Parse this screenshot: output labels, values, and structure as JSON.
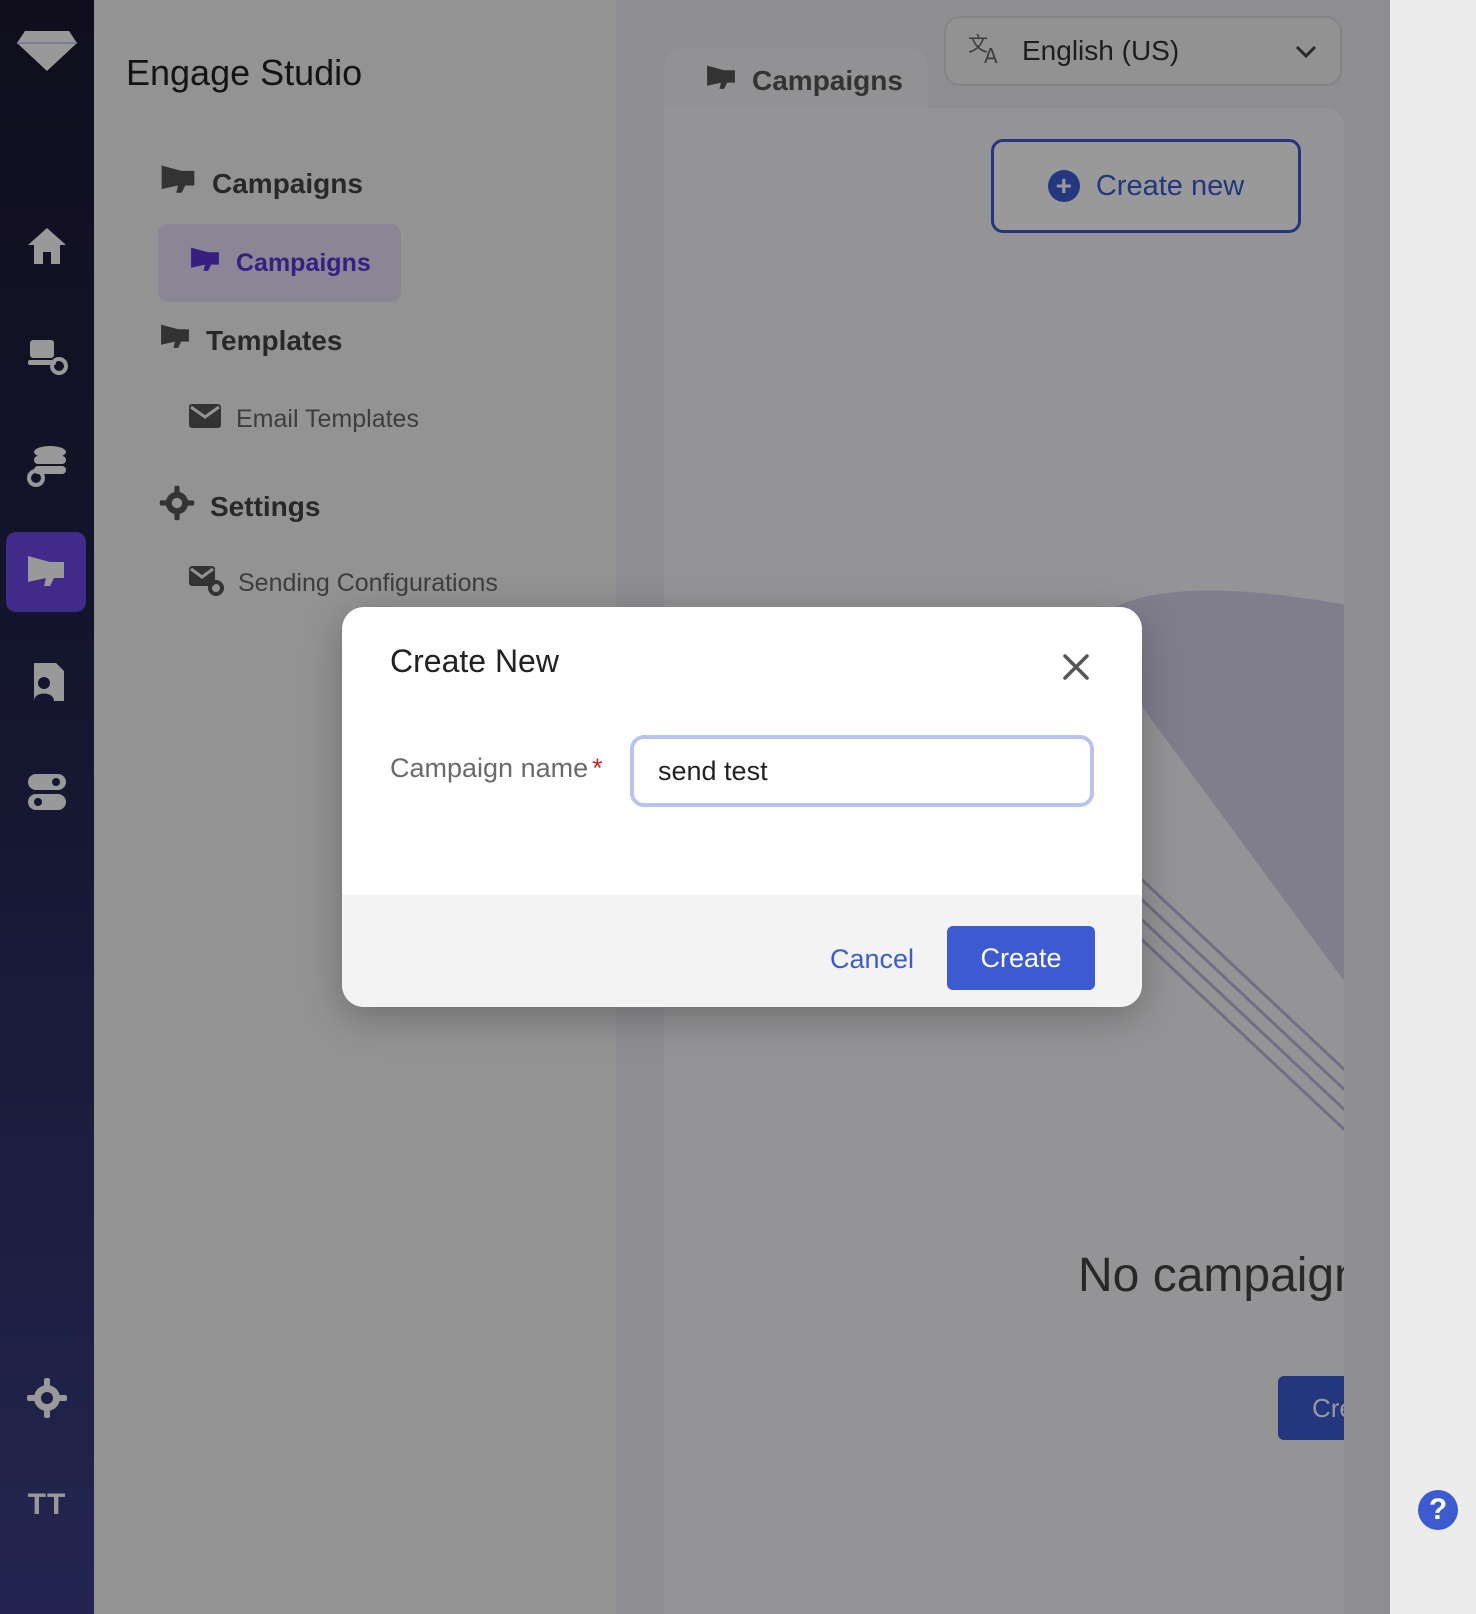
{
  "app": {
    "title": "Engage Studio",
    "user_initials": "TT"
  },
  "rail": {
    "icons": [
      "diamond-logo-icon",
      "home-icon",
      "device-settings-icon",
      "database-settings-icon",
      "megaphone-icon",
      "contact-report-icon",
      "toggle-icon",
      "gear-icon"
    ]
  },
  "nav": {
    "sections": [
      {
        "label": "Campaigns",
        "icon": "megaphone-icon",
        "items": [
          {
            "label": "Campaigns",
            "icon": "megaphone-icon",
            "selected": true
          }
        ]
      },
      {
        "label": "Templates",
        "icon": "megaphone-icon",
        "items": [
          {
            "label": "Email Templates",
            "icon": "mail-icon"
          }
        ]
      },
      {
        "label": "Settings",
        "icon": "gear-icon",
        "items": [
          {
            "label": "Sending Configurations",
            "icon": "mail-settings-icon"
          }
        ]
      }
    ]
  },
  "content": {
    "tab_label": "Campaigns",
    "language": "English (US)",
    "create_new_label": "Create new",
    "empty_state_text": "No campaign",
    "empty_state_button": "Crea"
  },
  "help_label": "?",
  "modal": {
    "title": "Create New",
    "field_label": "Campaign name",
    "required_marker": "*",
    "field_value": "send test",
    "cancel_label": "Cancel",
    "create_label": "Create"
  },
  "colors": {
    "accent": "#3d5bd1",
    "active_purple": "#6d49e6",
    "rail": "#1b1830"
  }
}
